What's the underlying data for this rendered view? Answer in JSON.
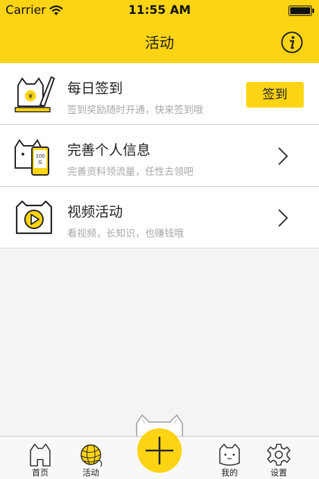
{
  "status_bar": {
    "carrier": "Carrier",
    "time": "11:55 AM"
  },
  "nav": {
    "title": "活动"
  },
  "activities": [
    {
      "title": "每日签到",
      "subtitle": "签到奖励随时开通，快来签到哦",
      "action_label": "签到",
      "icon": "cat-pen-icon"
    },
    {
      "title": "完善个人信息",
      "subtitle": "完善资料领流量，任性去领吧",
      "icon": "cat-phone-icon"
    },
    {
      "title": "视频活动",
      "subtitle": "看视频，长知识，也赚钱哦",
      "icon": "video-play-icon"
    }
  ],
  "tabs": [
    {
      "label": "首页",
      "icon": "cat-home-icon"
    },
    {
      "label": "活动",
      "icon": "yarn-ball-icon"
    },
    {
      "label": "我的",
      "icon": "cat-face-icon"
    },
    {
      "label": "设置",
      "icon": "gear-icon"
    }
  ],
  "colors": {
    "accent": "#fcd413",
    "text": "#222222",
    "subtext": "#a8a8a8"
  }
}
